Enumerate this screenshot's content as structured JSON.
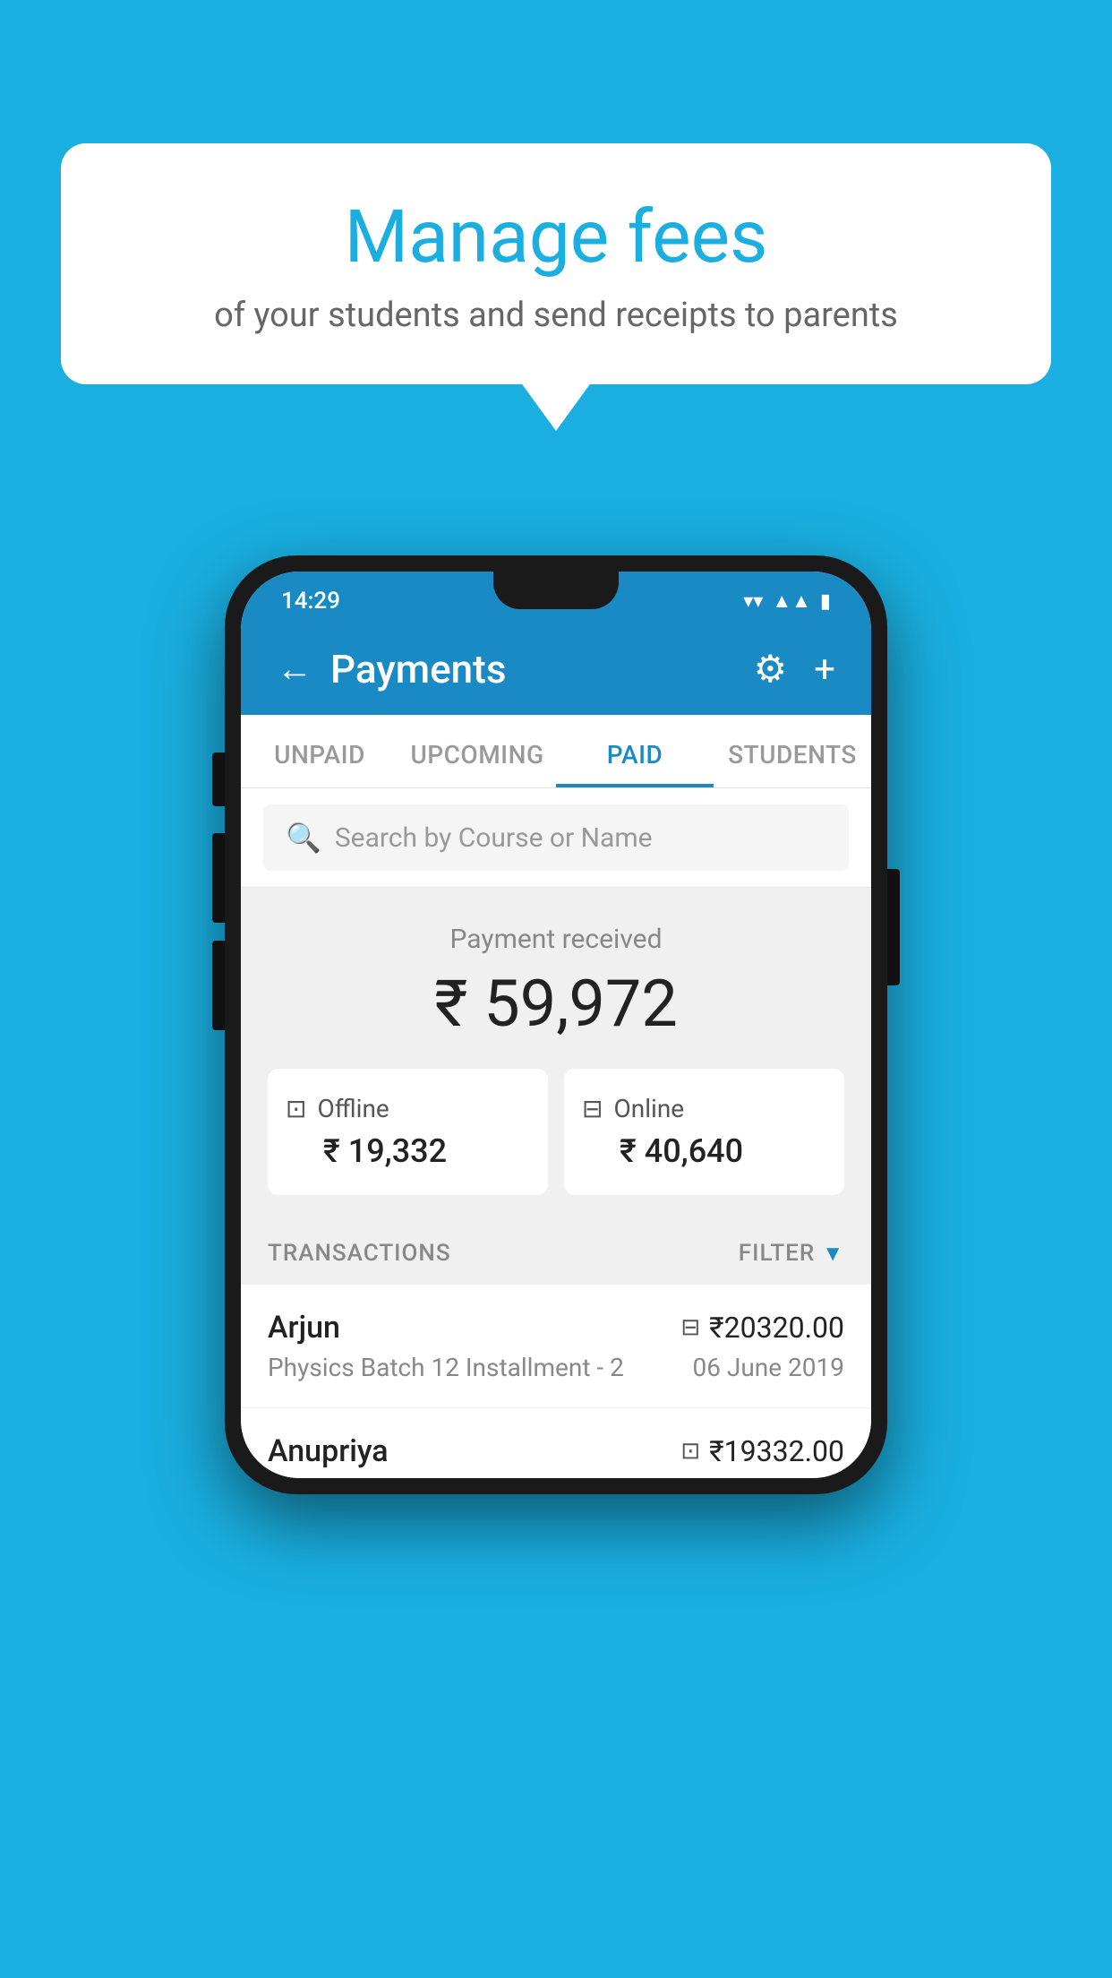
{
  "background_color": "#1AAFE0",
  "speech_bubble": {
    "title": "Manage fees",
    "subtitle": "of your students and send receipts to parents"
  },
  "phone": {
    "status_bar": {
      "time": "14:29"
    },
    "header": {
      "title": "Payments",
      "back_label": "←",
      "gear_label": "⚙",
      "plus_label": "+"
    },
    "tabs": [
      {
        "label": "UNPAID",
        "active": false
      },
      {
        "label": "UPCOMING",
        "active": false
      },
      {
        "label": "PAID",
        "active": true
      },
      {
        "label": "STUDENTS",
        "active": false
      }
    ],
    "search": {
      "placeholder": "Search by Course or Name"
    },
    "payment_summary": {
      "label": "Payment received",
      "amount": "₹ 59,972",
      "offline_label": "Offline",
      "offline_amount": "₹ 19,332",
      "online_label": "Online",
      "online_amount": "₹ 40,640"
    },
    "transactions_section": {
      "label": "TRANSACTIONS",
      "filter_label": "FILTER"
    },
    "transactions": [
      {
        "name": "Arjun",
        "amount": "₹20320.00",
        "payment_type": "card",
        "course": "Physics Batch 12 Installment - 2",
        "date": "06 June 2019"
      },
      {
        "name": "Anupriya",
        "amount": "₹19332.00",
        "payment_type": "cash",
        "course": "",
        "date": ""
      }
    ]
  }
}
